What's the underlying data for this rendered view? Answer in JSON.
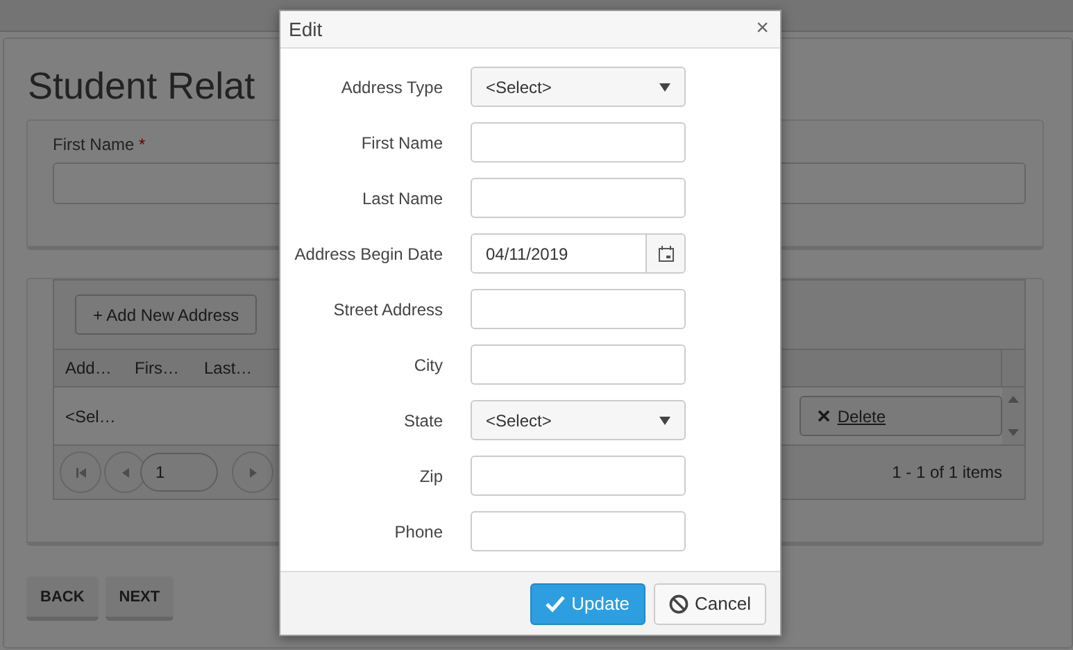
{
  "background_page": {
    "title": "Student Relat",
    "first_name_field": {
      "label": "First Name",
      "required_mark": "*"
    },
    "grid": {
      "add_button": "+ Add New Address",
      "columns": [
        "Add…",
        "Firs…",
        "Last…"
      ],
      "rows": [
        {
          "cells": [
            "<Sel…"
          ],
          "delete_button": "Delete"
        }
      ],
      "pager": {
        "page": "1",
        "summary": "1 - 1 of 1 items"
      }
    },
    "nav_buttons": [
      "BACK",
      "NEXT"
    ]
  },
  "dialog": {
    "title": "Edit",
    "close": "×",
    "fields": [
      {
        "label": "Address Type",
        "kind": "select",
        "value": "<Select>"
      },
      {
        "label": "First Name",
        "kind": "text"
      },
      {
        "label": "Last Name",
        "kind": "text"
      },
      {
        "label": "Address Begin Date",
        "kind": "date",
        "value": "04/11/2019"
      },
      {
        "label": "Street Address",
        "kind": "text"
      },
      {
        "label": "City",
        "kind": "text"
      },
      {
        "label": "State",
        "kind": "select",
        "value": "<Select>"
      },
      {
        "label": "Zip",
        "kind": "text"
      },
      {
        "label": "Phone",
        "kind": "text"
      }
    ],
    "buttons": [
      {
        "label": "Update",
        "kind": "primary"
      },
      {
        "label": "Cancel",
        "kind": "secondary"
      }
    ]
  }
}
